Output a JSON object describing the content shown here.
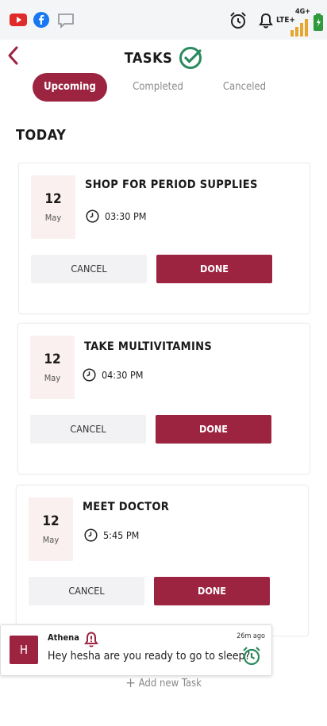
{
  "status_bar": {
    "icons": [
      "youtube-icon",
      "facebook-icon",
      "message-icon",
      "alarm-icon",
      "bell-icon",
      "signal-icon",
      "battery-icon"
    ],
    "network_label": "LTE+",
    "network_gen": "4G+"
  },
  "header": {
    "title": "TASKS",
    "back_icon": "chevron-left-icon",
    "title_icon": "check-circle-icon"
  },
  "tabs": [
    {
      "label": "Upcoming",
      "active": true
    },
    {
      "label": "Completed",
      "active": false
    },
    {
      "label": "Canceled",
      "active": false
    }
  ],
  "section_title": "TODAY",
  "tasks": [
    {
      "day": "12",
      "month": "May",
      "title": "SHOP FOR PERIOD SUPPLIES",
      "time": "03:30 PM",
      "cancel_label": "CANCEL",
      "done_label": "DONE"
    },
    {
      "day": "12",
      "month": "May",
      "title": "TAKE MULTIVITAMINS",
      "time": "04:30 PM",
      "cancel_label": "CANCEL",
      "done_label": "DONE"
    },
    {
      "day": "12",
      "month": "May",
      "title": "MEET DOCTOR",
      "time": "5:45  PM",
      "cancel_label": "CANCEL",
      "done_label": "DONE"
    }
  ],
  "notification": {
    "avatar_letter": "H",
    "sender": "Athena",
    "time": "26m ago",
    "message": "Hey hesha are you ready to go to sleep?"
  },
  "add_new_label": "Add new  Task",
  "colors": {
    "accent": "#9c2440",
    "check_green": "#2a8a5e",
    "date_bg": "#fbf0f0"
  }
}
